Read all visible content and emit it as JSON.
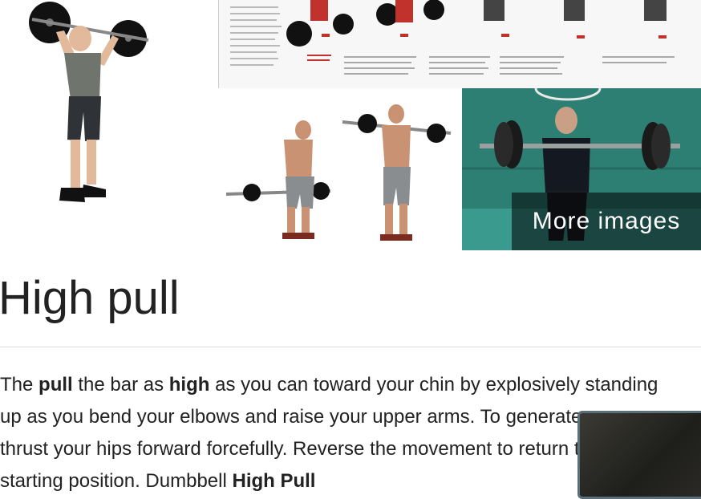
{
  "images": {
    "tile1_alt": "Man performing barbell high pull, standing with bar at shoulder level",
    "tile2_alt": "Illustrated step-by-step high pull instruction sheet",
    "tile3_alt": "Man shown bending with barbell then pulling it to chest",
    "tile4_alt": "Man performing upright barbell pull in gym with green mats",
    "more_images_label": "More images"
  },
  "article": {
    "title": "High pull",
    "desc_1": "The ",
    "desc_b1": "pull",
    "desc_2": " the bar as ",
    "desc_b2": "high",
    "desc_3": " as you can toward your chin by explosively standing up as you bend your elbows and raise your upper arms. To generate power, thrust your hips forward forcefully. Reverse the movement to return to the starting position. Dumbbell ",
    "desc_b3": "High Pull"
  },
  "colors": {
    "overlay_bg": "rgba(0,0,0,0.55)",
    "gym_wall": "#2d7f74",
    "text": "#222222",
    "divider": "#dadce0"
  }
}
